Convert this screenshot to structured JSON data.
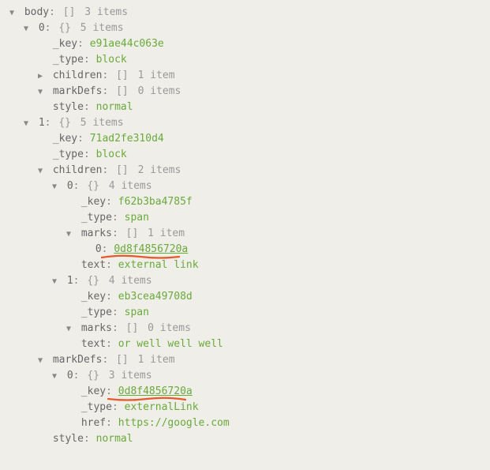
{
  "glyphs": {
    "down": "▼",
    "right": "▶"
  },
  "body": {
    "label": "body",
    "brackets": "[]",
    "count": "3 items",
    "items": [
      {
        "idx": "0",
        "brackets": "{}",
        "count": "5 items",
        "key": {
          "label": "_key",
          "value": "e91ae44c063e"
        },
        "type": {
          "label": "_type",
          "value": "block"
        },
        "children": {
          "label": "children",
          "brackets": "[]",
          "count": "1 item"
        },
        "markDefs": {
          "label": "markDefs",
          "brackets": "[]",
          "count": "0 items"
        },
        "style": {
          "label": "style",
          "value": "normal"
        }
      },
      {
        "idx": "1",
        "brackets": "{}",
        "count": "5 items",
        "key": {
          "label": "_key",
          "value": "71ad2fe310d4"
        },
        "type": {
          "label": "_type",
          "value": "block"
        },
        "children": {
          "label": "children",
          "brackets": "[]",
          "count": "2 items",
          "items": [
            {
              "idx": "0",
              "brackets": "{}",
              "count": "4 items",
              "key": {
                "label": "_key",
                "value": "f62b3ba4785f"
              },
              "type": {
                "label": "_type",
                "value": "span"
              },
              "marks": {
                "label": "marks",
                "brackets": "[]",
                "count": "1 item",
                "item": {
                  "idx": "0",
                  "value": "0d8f4856720a"
                }
              },
              "text": {
                "label": "text",
                "value": "external link"
              }
            },
            {
              "idx": "1",
              "brackets": "{}",
              "count": "4 items",
              "key": {
                "label": "_key",
                "value": "eb3cea49708d"
              },
              "type": {
                "label": "_type",
                "value": "span"
              },
              "marks": {
                "label": "marks",
                "brackets": "[]",
                "count": "0 items"
              },
              "text": {
                "label": "text",
                "value": " or well well well"
              }
            }
          ]
        },
        "markDefs": {
          "label": "markDefs",
          "brackets": "[]",
          "count": "1 item",
          "item": {
            "idx": "0",
            "brackets": "{}",
            "count": "3 items",
            "key": {
              "label": "_key",
              "value": "0d8f4856720a"
            },
            "type": {
              "label": "_type",
              "value": "externalLink"
            },
            "href": {
              "label": "href",
              "value": "https://google.com"
            }
          }
        },
        "style": {
          "label": "style",
          "value": "normal"
        }
      }
    ]
  }
}
